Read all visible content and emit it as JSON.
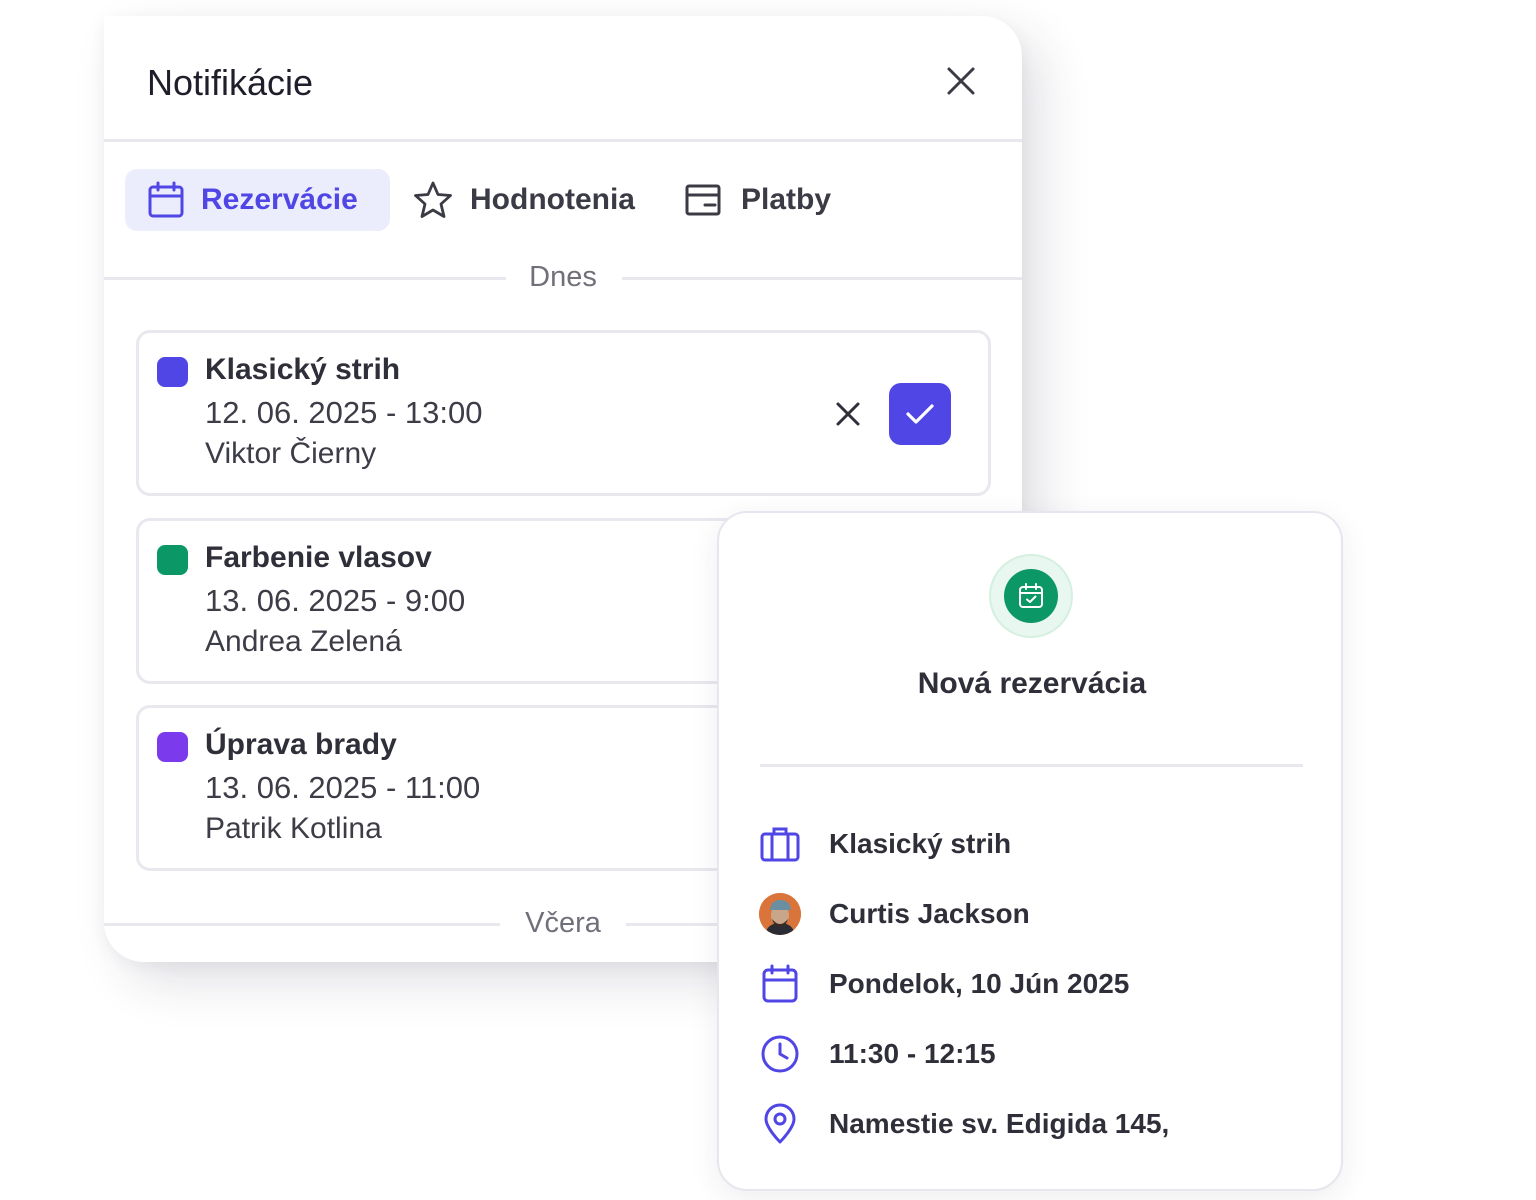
{
  "panel": {
    "title": "Notifikácie",
    "tabs": [
      {
        "label": "Rezervácie",
        "icon": "calendar-icon",
        "active": true
      },
      {
        "label": "Hodnotenia",
        "icon": "star-icon",
        "active": false
      },
      {
        "label": "Platby",
        "icon": "wallet-icon",
        "active": false
      }
    ],
    "section_today": "Dnes",
    "section_yesterday": "Včera",
    "items": [
      {
        "title": "Klasický strih",
        "datetime": "12. 06. 2025 - 13:00",
        "client": "Viktor Čierny",
        "color": "#4f46e5"
      },
      {
        "title": "Farbenie vlasov",
        "datetime": "13. 06. 2025 - 9:00",
        "client": "Andrea Zelená",
        "color": "#0c9767"
      },
      {
        "title": "Úprava brady",
        "datetime": "13. 06. 2025 - 11:00",
        "client": "Patrik Kotlina",
        "color": "#7c3aed"
      }
    ]
  },
  "popup": {
    "title": "Nová rezervácia",
    "service": "Klasický strih",
    "client": "Curtis Jackson",
    "date": "Pondelok, 10 Jún 2025",
    "time": "11:30 - 12:15",
    "address": "Namestie sv. Edigida 145,"
  },
  "colors": {
    "accent": "#4f46e5",
    "accent_bg": "#ecedfc",
    "success": "#0c9767",
    "violet": "#7c3aed",
    "border": "#e8e8ee"
  }
}
